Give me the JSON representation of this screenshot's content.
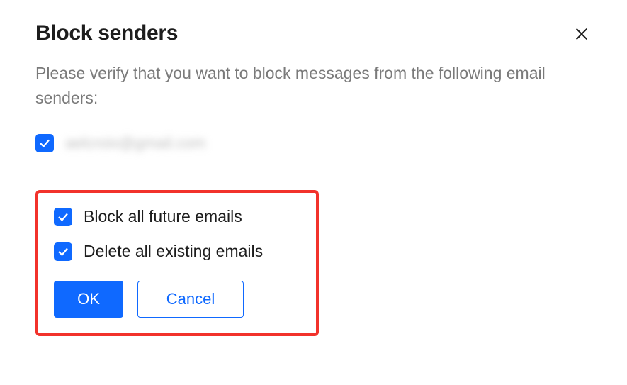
{
  "dialog": {
    "title": "Block senders",
    "description": "Please verify that you want to block messages from the following email senders:"
  },
  "senders": [
    {
      "email": "aelcroix@gmail.com",
      "checked": true
    }
  ],
  "options": {
    "block_future": {
      "label": "Block all future emails",
      "checked": true
    },
    "delete_existing": {
      "label": "Delete all existing emails",
      "checked": true
    }
  },
  "buttons": {
    "ok": "OK",
    "cancel": "Cancel"
  },
  "colors": {
    "accent": "#0f69ff",
    "highlight_border": "#f2322b"
  }
}
